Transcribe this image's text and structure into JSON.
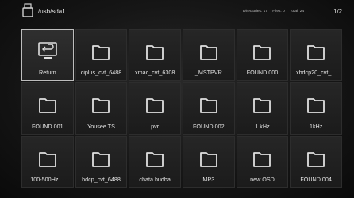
{
  "header": {
    "path": "/usb/sda1",
    "directories": "Directories: 17",
    "files": "Files: 0",
    "total": "Total: 24",
    "page": "1/2"
  },
  "items": [
    {
      "label": "Return",
      "icon": "return-icon",
      "selected": true
    },
    {
      "label": "ciplus_cvt_6488",
      "icon": "folder-icon"
    },
    {
      "label": "xmac_cvt_6308",
      "icon": "folder-icon"
    },
    {
      "label": "_MSTPVR",
      "icon": "folder-icon"
    },
    {
      "label": "FOUND.000",
      "icon": "folder-icon"
    },
    {
      "label": "xhdcp20_cvt_...",
      "icon": "folder-icon"
    },
    {
      "label": "FOUND.001",
      "icon": "folder-icon"
    },
    {
      "label": "Yousee TS",
      "icon": "folder-icon"
    },
    {
      "label": "pvr",
      "icon": "folder-icon"
    },
    {
      "label": "FOUND.002",
      "icon": "folder-icon"
    },
    {
      "label": "1 kHz",
      "icon": "folder-icon"
    },
    {
      "label": "1kHz",
      "icon": "folder-icon"
    },
    {
      "label": "100-500Hz ...",
      "icon": "folder-icon"
    },
    {
      "label": "hdcp_cvt_6488",
      "icon": "folder-icon"
    },
    {
      "label": "chata hudba",
      "icon": "folder-icon"
    },
    {
      "label": "MP3",
      "icon": "folder-icon"
    },
    {
      "label": "new OSD",
      "icon": "folder-icon"
    },
    {
      "label": "FOUND.004",
      "icon": "folder-icon"
    }
  ]
}
